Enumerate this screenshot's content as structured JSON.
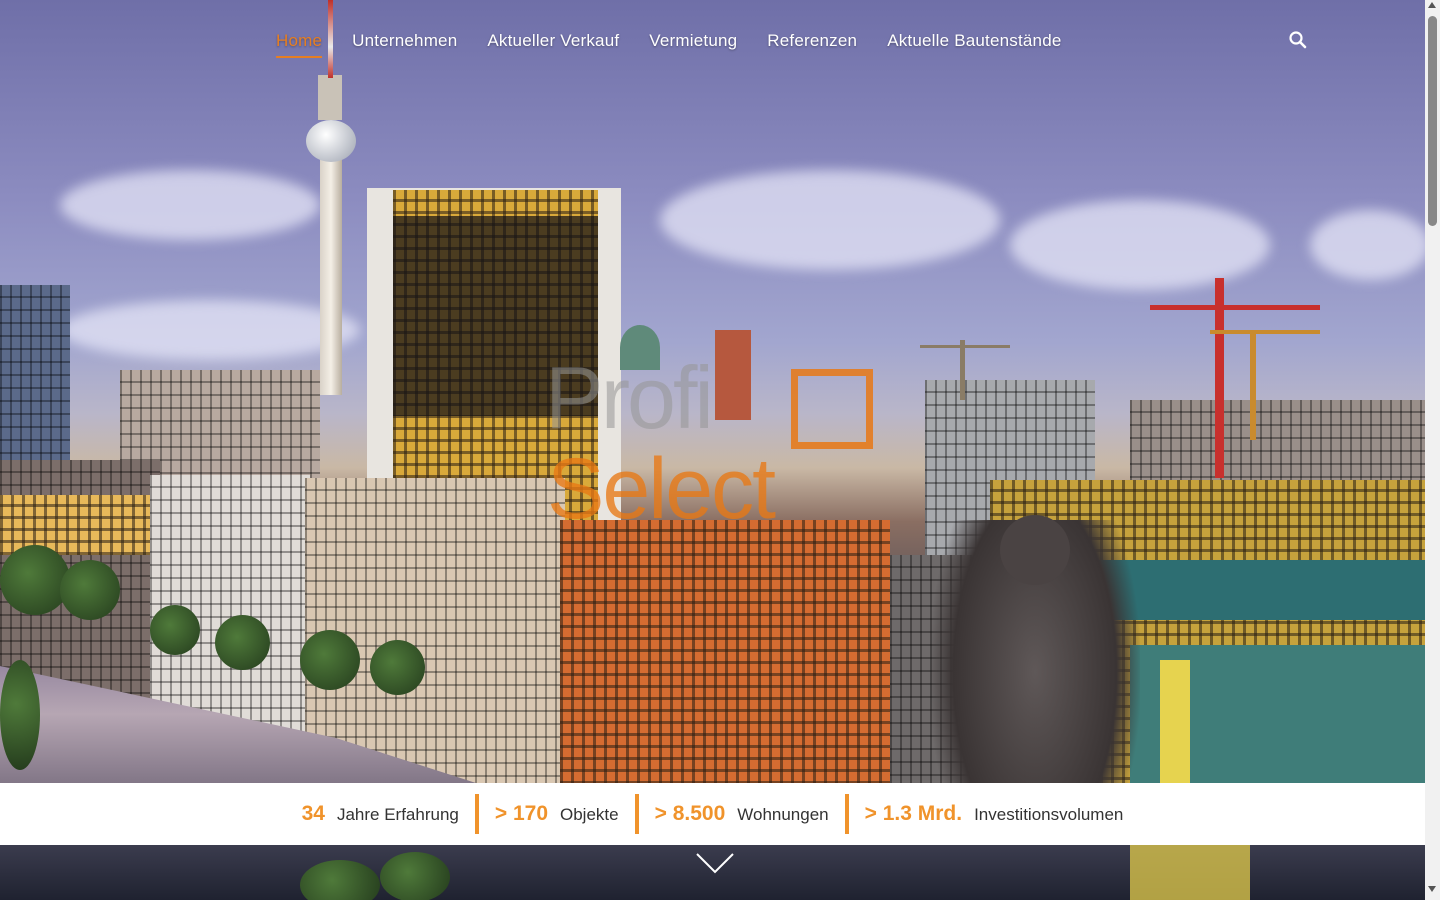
{
  "nav": {
    "items": [
      {
        "label": "Home",
        "active": true
      },
      {
        "label": "Unternehmen",
        "active": false
      },
      {
        "label": "Aktueller Verkauf",
        "active": false
      },
      {
        "label": "Vermietung",
        "active": false
      },
      {
        "label": "Referenzen",
        "active": false
      },
      {
        "label": "Aktuelle Bautenstände",
        "active": false
      }
    ],
    "search_icon": "search-icon"
  },
  "logo": {
    "line1": "Profi",
    "line2": "Select"
  },
  "stats": [
    {
      "value": "34",
      "label": "Jahre Erfahrung"
    },
    {
      "value": "> 170",
      "label": "Objekte"
    },
    {
      "value": "> 8.500",
      "label": "Wohnungen"
    },
    {
      "value": "> 1.3 Mrd.",
      "label": "Investitionsvolumen"
    }
  ],
  "scroll_icon": "chevron-down-icon",
  "colors": {
    "accent": "#e67e22",
    "stat_accent": "#f0932b",
    "nav_text": "#ffffff",
    "stats_bg": "#ffffff"
  }
}
